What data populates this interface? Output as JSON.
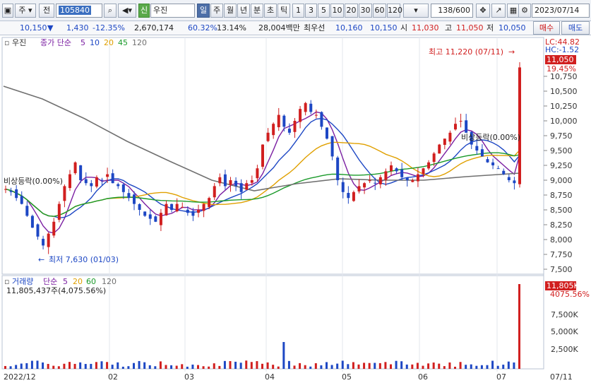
{
  "toolbar": {
    "menu_label": "주",
    "mode_label": "전",
    "code_value": "105840",
    "badge_label": "신",
    "stock_name": "우진",
    "periods": [
      "일",
      "주",
      "월",
      "년",
      "분",
      "초",
      "틱"
    ],
    "active_period": "일",
    "intervals": [
      "1",
      "3",
      "5",
      "10",
      "20",
      "30",
      "60",
      "120"
    ],
    "count_value": "138",
    "count_total": "/600",
    "date_value": "2023/07/14"
  },
  "infobar": {
    "price": "10,150",
    "change_arrow": "▼",
    "change": "1,430",
    "change_rate": "-12.35%",
    "volume": "2,670,174",
    "ratio1": "60.32%",
    "ratio2": "13.14%",
    "trade_value": "28,004백만",
    "best_label": "최우선",
    "best_ask": "10,160",
    "best_bid": "10,150",
    "open_label": "시",
    "open": "11,030",
    "high_label": "고",
    "high": "11,050",
    "low_label": "저",
    "low": "10,050",
    "buy_button": "매수",
    "sell_button": "매도"
  },
  "price_panel": {
    "legend_name": "우진",
    "legend_ma_label": "종가 단순",
    "legend_periods": [
      "5",
      "10",
      "20",
      "45",
      "120"
    ],
    "lc_label": "LC:44.82",
    "hc_label": "HC:-1.52",
    "current_price_tag": "11,050",
    "current_pct_tag": "19.45%",
    "high_annotation": "최고 11,220 (07/11)",
    "low_annotation": "최저 7,630 (01/03)",
    "left_marker": "비상등락(0.00%)",
    "right_marker": "비상등락(0.00%)",
    "y_ticks": [
      "10,750",
      "10,500",
      "10,250",
      "10,000",
      "9,750",
      "9,500",
      "9,250",
      "9,000",
      "8,750",
      "8,500",
      "8,250",
      "8,000",
      "7,750",
      "7,500"
    ]
  },
  "volume_panel": {
    "legend_name": "거래량",
    "legend_ma_label": "단순",
    "legend_periods": [
      "5",
      "20",
      "60",
      "120"
    ],
    "value_line": "11,805,437주(4,075.56%)",
    "current_volume_tag": "11,805K",
    "current_pct_tag": "4075.56%",
    "y_ticks": [
      "7,500K",
      "5,000K",
      "2,500K"
    ]
  },
  "x_axis": {
    "labels": [
      "2022/12",
      "02",
      "03",
      "04",
      "05",
      "06",
      "07",
      "07/11"
    ]
  },
  "colors": {
    "up": "#d11f1f",
    "down": "#1d47c4",
    "ma5": "#7b1fa2",
    "ma10": "#1d47c4",
    "ma20": "#e0a000",
    "ma45": "#1a9a2a",
    "ma120": "#707070"
  }
}
